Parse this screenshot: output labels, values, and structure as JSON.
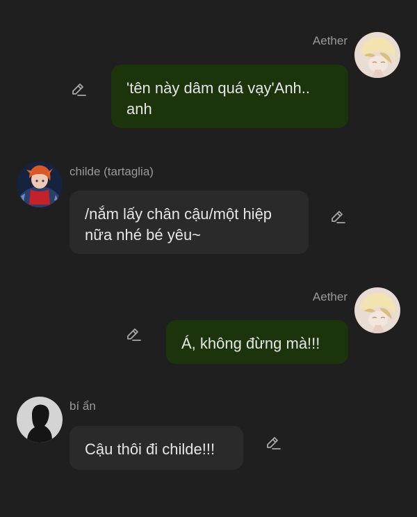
{
  "messages": [
    {
      "sender": "Aether",
      "text": "'tên này dâm quá vạy'Anh.. anh",
      "direction": "out",
      "avatar_icon": "aether-avatar-icon",
      "edit_icon": "pencil-icon"
    },
    {
      "sender": "childe (tartaglia)",
      "text": "/nắm lấy chân cậu/một hiệp nữa nhé bé yêu~",
      "direction": "in",
      "avatar_icon": "childe-avatar-icon",
      "edit_icon": "pencil-icon"
    },
    {
      "sender": "Aether",
      "text": "Á, không đừng mà!!!",
      "direction": "out",
      "avatar_icon": "aether-avatar-icon",
      "edit_icon": "pencil-icon"
    },
    {
      "sender": "bí ẩn",
      "text": "Cậu thôi đi childe!!!",
      "direction": "in",
      "avatar_icon": "silhouette-avatar-icon",
      "edit_icon": "pencil-icon"
    }
  ],
  "colors": {
    "background": "#1f1f1f",
    "outgoing_bubble": "#1c340c",
    "incoming_bubble": "#2a2a2a",
    "message_text": "#e6e6e6",
    "sender_name": "#9a9a9a",
    "icon": "#a8a8a8"
  }
}
